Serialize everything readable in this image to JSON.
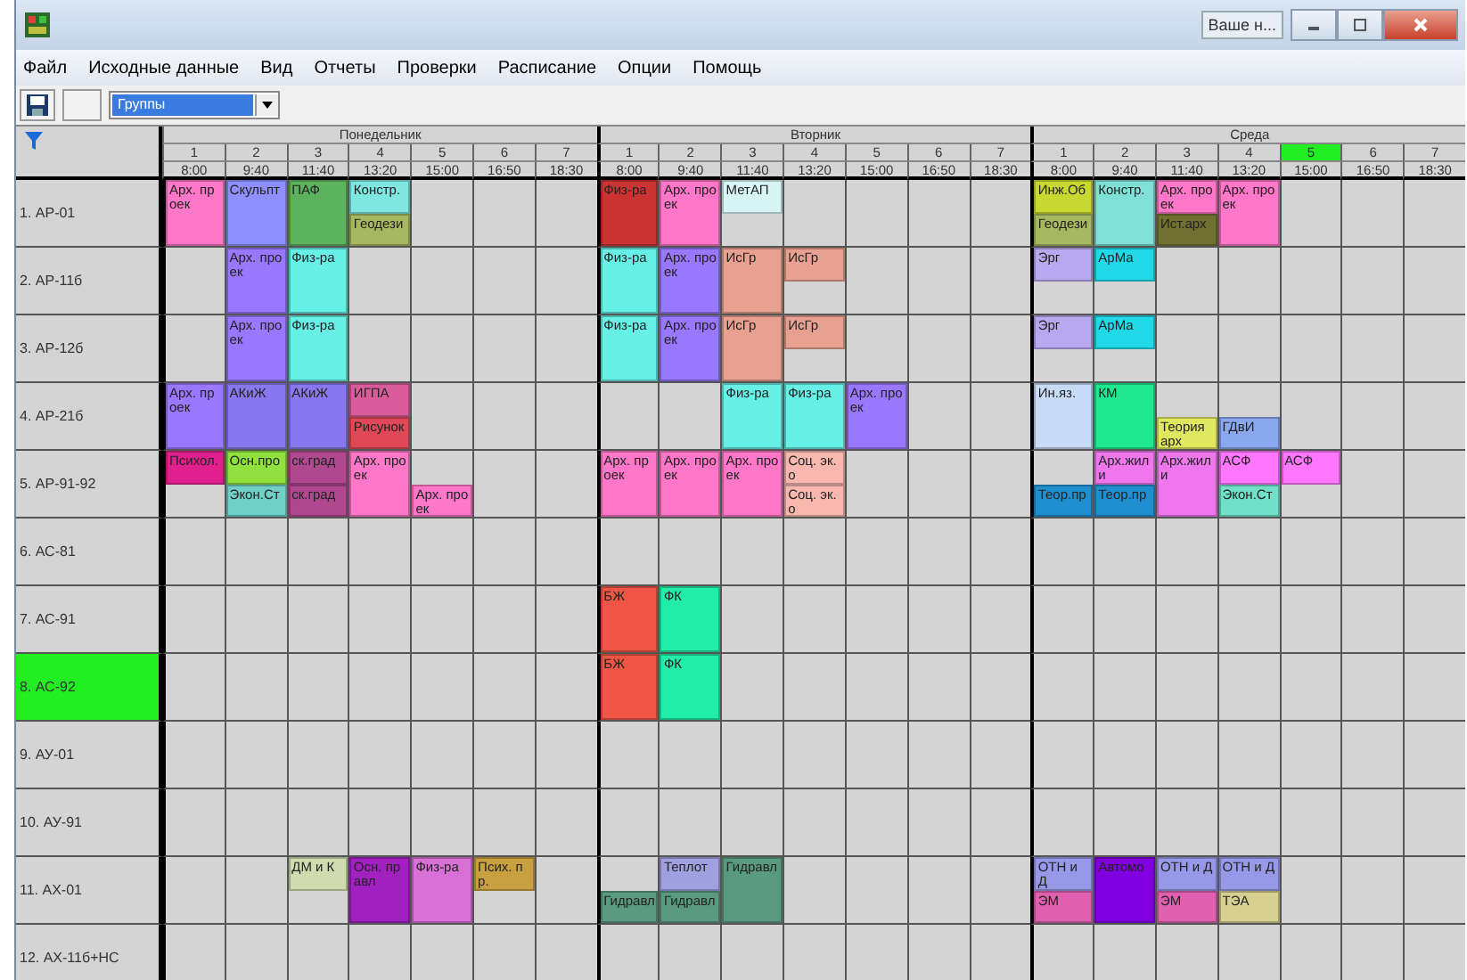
{
  "window": {
    "title_button": "Ваше н..."
  },
  "menu": [
    "Файл",
    "Исходные данные",
    "Вид",
    "Отчеты",
    "Проверки",
    "Расписание",
    "Опции",
    "Помощь"
  ],
  "toolbar": {
    "view_select": "Группы"
  },
  "days": [
    {
      "name": "Понедельник",
      "pairs": [
        {
          "number": "1",
          "time": "8:00",
          "selected": false
        },
        {
          "number": "2",
          "time": "9:40",
          "selected": false
        },
        {
          "number": "3",
          "time": "11:40",
          "selected": false
        },
        {
          "number": "4",
          "time": "13:20",
          "selected": false
        },
        {
          "number": "5",
          "time": "15:00",
          "selected": false
        },
        {
          "number": "6",
          "time": "16:50",
          "selected": false
        },
        {
          "number": "7",
          "time": "18:30",
          "selected": false
        }
      ]
    },
    {
      "name": "Вторник",
      "pairs": [
        {
          "number": "1",
          "time": "8:00",
          "selected": false
        },
        {
          "number": "2",
          "time": "9:40",
          "selected": false
        },
        {
          "number": "3",
          "time": "11:40",
          "selected": false
        },
        {
          "number": "4",
          "time": "13:20",
          "selected": false
        },
        {
          "number": "5",
          "time": "15:00",
          "selected": false
        },
        {
          "number": "6",
          "time": "16:50",
          "selected": false
        },
        {
          "number": "7",
          "time": "18:30",
          "selected": false
        }
      ]
    },
    {
      "name": "Среда",
      "pairs": [
        {
          "number": "1",
          "time": "8:00",
          "selected": false
        },
        {
          "number": "2",
          "time": "9:40",
          "selected": false
        },
        {
          "number": "3",
          "time": "11:40",
          "selected": false
        },
        {
          "number": "4",
          "time": "13:20",
          "selected": false
        },
        {
          "number": "5",
          "time": "15:00",
          "selected": true
        },
        {
          "number": "6",
          "time": "16:50",
          "selected": false
        },
        {
          "number": "7",
          "time": "18:30",
          "selected": false
        }
      ]
    }
  ],
  "groups": [
    {
      "name": "1. АР-01",
      "selected": false,
      "cells": [
        {
          "kind": "full",
          "label": "Арх. проек",
          "color": "#ff77c8"
        },
        {
          "kind": "full",
          "label": "Скульпт",
          "color": "#8f8fff"
        },
        {
          "kind": "full",
          "label": "ПАФ",
          "color": "#5db35d"
        },
        {
          "kind": "split",
          "top": {
            "label": "Констр.",
            "color": "#7fe6e0"
          },
          "bottom": {
            "label": "Геодези",
            "color": "#a8b860"
          }
        },
        {
          "kind": "empty"
        },
        {
          "kind": "empty"
        },
        {
          "kind": "empty"
        },
        {
          "kind": "full",
          "label": "Физ-ра",
          "color": "#cc3333"
        },
        {
          "kind": "full",
          "label": "Арх. проек",
          "color": "#ff77c8"
        },
        {
          "kind": "split",
          "top": {
            "label": "МетАП",
            "color": "#d8f5f5"
          }
        },
        {
          "kind": "empty"
        },
        {
          "kind": "empty"
        },
        {
          "kind": "empty"
        },
        {
          "kind": "empty"
        },
        {
          "kind": "split",
          "top": {
            "label": "Инж.Об",
            "color": "#c8d830"
          },
          "bottom": {
            "label": "Геодези",
            "color": "#a8b860"
          }
        },
        {
          "kind": "full",
          "label": "Констр.",
          "color": "#80e0d8"
        },
        {
          "kind": "split",
          "top": {
            "label": "Арх. проек",
            "color": "#ff77c8"
          },
          "bottom": {
            "label": "Ист.арх",
            "color": "#707030"
          }
        },
        {
          "kind": "full",
          "label": "Арх. проек",
          "color": "#ff77c8"
        },
        {
          "kind": "empty"
        },
        {
          "kind": "empty"
        },
        {
          "kind": "empty"
        }
      ]
    },
    {
      "name": "2. АР-11б",
      "selected": false,
      "cells": [
        {
          "kind": "empty"
        },
        {
          "kind": "full",
          "label": "Арх. проек",
          "color": "#9977ff"
        },
        {
          "kind": "full",
          "label": "Физ-ра",
          "color": "#66f0e6"
        },
        {
          "kind": "empty"
        },
        {
          "kind": "empty"
        },
        {
          "kind": "empty"
        },
        {
          "kind": "empty"
        },
        {
          "kind": "full",
          "label": "Физ-ра",
          "color": "#66f0e6"
        },
        {
          "kind": "full",
          "label": "Арх. проек",
          "color": "#9977ff"
        },
        {
          "kind": "full",
          "label": "ИсГр",
          "color": "#e8a090"
        },
        {
          "kind": "split",
          "top": {
            "label": "ИсГр",
            "color": "#e8a090"
          }
        },
        {
          "kind": "empty"
        },
        {
          "kind": "empty"
        },
        {
          "kind": "empty"
        },
        {
          "kind": "split",
          "top": {
            "label": "Эрг",
            "color": "#b8a8f0"
          }
        },
        {
          "kind": "split",
          "top": {
            "label": "АрМа",
            "color": "#20d8e8"
          }
        },
        {
          "kind": "empty"
        },
        {
          "kind": "empty"
        },
        {
          "kind": "empty"
        },
        {
          "kind": "empty"
        },
        {
          "kind": "empty"
        }
      ]
    },
    {
      "name": "3. АР-12б",
      "selected": false,
      "cells": [
        {
          "kind": "empty"
        },
        {
          "kind": "full",
          "label": "Арх. проек",
          "color": "#9977ff"
        },
        {
          "kind": "full",
          "label": "Физ-ра",
          "color": "#66f0e6"
        },
        {
          "kind": "empty"
        },
        {
          "kind": "empty"
        },
        {
          "kind": "empty"
        },
        {
          "kind": "empty"
        },
        {
          "kind": "full",
          "label": "Физ-ра",
          "color": "#66f0e6"
        },
        {
          "kind": "full",
          "label": "Арх. проек",
          "color": "#9977ff"
        },
        {
          "kind": "full",
          "label": "ИсГр",
          "color": "#e8a090"
        },
        {
          "kind": "split",
          "top": {
            "label": "ИсГр",
            "color": "#e8a090"
          }
        },
        {
          "kind": "empty"
        },
        {
          "kind": "empty"
        },
        {
          "kind": "empty"
        },
        {
          "kind": "split",
          "top": {
            "label": "Эрг",
            "color": "#b8a8f0"
          }
        },
        {
          "kind": "split",
          "top": {
            "label": "АрМа",
            "color": "#20d8e8"
          }
        },
        {
          "kind": "empty"
        },
        {
          "kind": "empty"
        },
        {
          "kind": "empty"
        },
        {
          "kind": "empty"
        },
        {
          "kind": "empty"
        }
      ]
    },
    {
      "name": "4. АР-21б",
      "selected": false,
      "cells": [
        {
          "kind": "full",
          "label": "Арх. проек",
          "color": "#9977ff"
        },
        {
          "kind": "full",
          "label": "АКиЖ",
          "color": "#8877ee"
        },
        {
          "kind": "full",
          "label": "АКиЖ",
          "color": "#8877ee"
        },
        {
          "kind": "split",
          "top": {
            "label": "ИГПА",
            "color": "#d85c9c"
          },
          "bottom": {
            "label": "Рисунок",
            "color": "#e04858"
          }
        },
        {
          "kind": "empty"
        },
        {
          "kind": "empty"
        },
        {
          "kind": "empty"
        },
        {
          "kind": "empty"
        },
        {
          "kind": "empty"
        },
        {
          "kind": "full",
          "label": "Физ-ра",
          "color": "#66f0e6"
        },
        {
          "kind": "full",
          "label": "Физ-ра",
          "color": "#66f0e6"
        },
        {
          "kind": "full",
          "label": "Арх. проек",
          "color": "#9977ff"
        },
        {
          "kind": "empty"
        },
        {
          "kind": "empty"
        },
        {
          "kind": "full",
          "label": "Ин.яз.",
          "color": "#c8dcf8"
        },
        {
          "kind": "full",
          "label": "КМ",
          "color": "#20e890"
        },
        {
          "kind": "split",
          "bottom": {
            "label": "Теория арх",
            "color": "#e0e860"
          }
        },
        {
          "kind": "split",
          "bottom": {
            "label": "ГДвИ",
            "color": "#8aa8f0"
          }
        },
        {
          "kind": "empty"
        },
        {
          "kind": "empty"
        },
        {
          "kind": "empty"
        }
      ]
    },
    {
      "name": "5. АР-91-92",
      "selected": false,
      "cells": [
        {
          "kind": "split",
          "top": {
            "label": "Психол.",
            "color": "#e0208c"
          }
        },
        {
          "kind": "split",
          "top": {
            "label": "Осн.про",
            "color": "#90e040"
          },
          "bottom": {
            "label": "Экон.Ст",
            "color": "#70d0c8"
          }
        },
        {
          "kind": "split",
          "top": {
            "label": "ск.град",
            "color": "#b04890"
          },
          "bottom": {
            "label": "ск.град",
            "color": "#b04890"
          }
        },
        {
          "kind": "full",
          "label": "Арх. проек",
          "color": "#ff77c8"
        },
        {
          "kind": "split",
          "bottom": {
            "label": "Арх. проек",
            "color": "#ff77c8"
          }
        },
        {
          "kind": "empty"
        },
        {
          "kind": "empty"
        },
        {
          "kind": "full",
          "label": "Арх. проек",
          "color": "#ff77c8"
        },
        {
          "kind": "full",
          "label": "Арх. проек",
          "color": "#ff77c8"
        },
        {
          "kind": "full",
          "label": "Арх. проек",
          "color": "#ff77c8"
        },
        {
          "kind": "split",
          "top": {
            "label": "Соц. эк. о",
            "color": "#f8b8b0"
          },
          "bottom": {
            "label": "Соц. эк. о",
            "color": "#f8b8b0"
          }
        },
        {
          "kind": "empty"
        },
        {
          "kind": "empty"
        },
        {
          "kind": "empty"
        },
        {
          "kind": "split",
          "bottom": {
            "label": "Теор.пр",
            "color": "#1f8fd0"
          }
        },
        {
          "kind": "split",
          "top": {
            "label": "Арх.жил и",
            "color": "#ee77ee"
          },
          "bottom": {
            "label": "Теор.пр",
            "color": "#1f8fd0"
          }
        },
        {
          "kind": "full",
          "label": "Арх.жил и",
          "color": "#ee77ee"
        },
        {
          "kind": "split",
          "top": {
            "label": "АСФ",
            "color": "#ff77ff"
          },
          "bottom": {
            "label": "Экон.Ст",
            "color": "#70e0c8"
          }
        },
        {
          "kind": "split",
          "top": {
            "label": "АСФ",
            "color": "#ff77ff"
          }
        },
        {
          "kind": "empty"
        },
        {
          "kind": "empty"
        }
      ]
    },
    {
      "name": "6. АС-81",
      "selected": false,
      "cells": [
        {
          "kind": "empty"
        },
        {
          "kind": "empty"
        },
        {
          "kind": "empty"
        },
        {
          "kind": "empty"
        },
        {
          "kind": "empty"
        },
        {
          "kind": "empty"
        },
        {
          "kind": "empty"
        },
        {
          "kind": "empty"
        },
        {
          "kind": "empty"
        },
        {
          "kind": "empty"
        },
        {
          "kind": "empty"
        },
        {
          "kind": "empty"
        },
        {
          "kind": "empty"
        },
        {
          "kind": "empty"
        },
        {
          "kind": "empty"
        },
        {
          "kind": "empty"
        },
        {
          "kind": "empty"
        },
        {
          "kind": "empty"
        },
        {
          "kind": "empty"
        },
        {
          "kind": "empty"
        },
        {
          "kind": "empty"
        }
      ]
    },
    {
      "name": "7. АС-91",
      "selected": false,
      "cells": [
        {
          "kind": "empty"
        },
        {
          "kind": "empty"
        },
        {
          "kind": "empty"
        },
        {
          "kind": "empty"
        },
        {
          "kind": "empty"
        },
        {
          "kind": "empty"
        },
        {
          "kind": "empty"
        },
        {
          "kind": "full",
          "label": "БЖ",
          "color": "#ee5544"
        },
        {
          "kind": "full",
          "label": "ФК",
          "color": "#22eeaa"
        },
        {
          "kind": "empty"
        },
        {
          "kind": "empty"
        },
        {
          "kind": "empty"
        },
        {
          "kind": "empty"
        },
        {
          "kind": "empty"
        },
        {
          "kind": "empty"
        },
        {
          "kind": "empty"
        },
        {
          "kind": "empty"
        },
        {
          "kind": "empty"
        },
        {
          "kind": "empty"
        },
        {
          "kind": "empty"
        },
        {
          "kind": "empty"
        }
      ]
    },
    {
      "name": "8. АС-92",
      "selected": true,
      "cells": [
        {
          "kind": "empty"
        },
        {
          "kind": "empty"
        },
        {
          "kind": "empty"
        },
        {
          "kind": "empty"
        },
        {
          "kind": "empty"
        },
        {
          "kind": "empty"
        },
        {
          "kind": "empty"
        },
        {
          "kind": "full",
          "label": "БЖ",
          "color": "#ee5544"
        },
        {
          "kind": "full",
          "label": "ФК",
          "color": "#22eeaa"
        },
        {
          "kind": "empty"
        },
        {
          "kind": "empty"
        },
        {
          "kind": "empty"
        },
        {
          "kind": "empty"
        },
        {
          "kind": "empty"
        },
        {
          "kind": "empty"
        },
        {
          "kind": "empty"
        },
        {
          "kind": "empty"
        },
        {
          "kind": "empty"
        },
        {
          "kind": "empty"
        },
        {
          "kind": "empty"
        },
        {
          "kind": "empty"
        }
      ]
    },
    {
      "name": "9. АУ-01",
      "selected": false,
      "cells": [
        {
          "kind": "empty"
        },
        {
          "kind": "empty"
        },
        {
          "kind": "empty"
        },
        {
          "kind": "empty"
        },
        {
          "kind": "empty"
        },
        {
          "kind": "empty"
        },
        {
          "kind": "empty"
        },
        {
          "kind": "empty"
        },
        {
          "kind": "empty"
        },
        {
          "kind": "empty"
        },
        {
          "kind": "empty"
        },
        {
          "kind": "empty"
        },
        {
          "kind": "empty"
        },
        {
          "kind": "empty"
        },
        {
          "kind": "empty"
        },
        {
          "kind": "empty"
        },
        {
          "kind": "empty"
        },
        {
          "kind": "empty"
        },
        {
          "kind": "empty"
        },
        {
          "kind": "empty"
        },
        {
          "kind": "empty"
        }
      ]
    },
    {
      "name": "10. АУ-91",
      "selected": false,
      "cells": [
        {
          "kind": "empty"
        },
        {
          "kind": "empty"
        },
        {
          "kind": "empty"
        },
        {
          "kind": "empty"
        },
        {
          "kind": "empty"
        },
        {
          "kind": "empty"
        },
        {
          "kind": "empty"
        },
        {
          "kind": "empty"
        },
        {
          "kind": "empty"
        },
        {
          "kind": "empty"
        },
        {
          "kind": "empty"
        },
        {
          "kind": "empty"
        },
        {
          "kind": "empty"
        },
        {
          "kind": "empty"
        },
        {
          "kind": "empty"
        },
        {
          "kind": "empty"
        },
        {
          "kind": "empty"
        },
        {
          "kind": "empty"
        },
        {
          "kind": "empty"
        },
        {
          "kind": "empty"
        },
        {
          "kind": "empty"
        }
      ]
    },
    {
      "name": "11. АХ-01",
      "selected": false,
      "cells": [
        {
          "kind": "empty"
        },
        {
          "kind": "empty"
        },
        {
          "kind": "split",
          "top": {
            "label": "ДМ и К",
            "color": "#d0dcb0"
          }
        },
        {
          "kind": "full",
          "label": "Осн. правл",
          "color": "#a020c0"
        },
        {
          "kind": "full",
          "label": "Физ-ра",
          "color": "#d870d8"
        },
        {
          "kind": "split",
          "top": {
            "label": "Псих. пр.",
            "color": "#c8a040"
          }
        },
        {
          "kind": "empty"
        },
        {
          "kind": "split",
          "bottom": {
            "label": "Гидравл",
            "color": "#5a9a80"
          }
        },
        {
          "kind": "split",
          "top": {
            "label": "Теплот",
            "color": "#a0a0e0"
          },
          "bottom": {
            "label": "Гидравл",
            "color": "#5a9a80"
          }
        },
        {
          "kind": "full",
          "label": "Гидравл",
          "color": "#5a9a80"
        },
        {
          "kind": "empty"
        },
        {
          "kind": "empty"
        },
        {
          "kind": "empty"
        },
        {
          "kind": "empty"
        },
        {
          "kind": "split",
          "top": {
            "label": "ОТН и Д",
            "color": "#9898e8"
          },
          "bottom": {
            "label": "ЭМ",
            "color": "#e060b0"
          }
        },
        {
          "kind": "full",
          "label": "Автомо",
          "color": "#8000e0"
        },
        {
          "kind": "split",
          "top": {
            "label": "ОТН и Д",
            "color": "#9898e8"
          },
          "bottom": {
            "label": "ЭМ",
            "color": "#e060b0"
          }
        },
        {
          "kind": "split",
          "top": {
            "label": "ОТН и Д",
            "color": "#9898e8"
          },
          "bottom": {
            "label": "ТЭА",
            "color": "#d8d090"
          }
        },
        {
          "kind": "empty"
        },
        {
          "kind": "empty"
        },
        {
          "kind": "empty"
        }
      ]
    },
    {
      "name": "12. АХ-11б+НС",
      "selected": false,
      "cells": [
        {
          "kind": "empty"
        },
        {
          "kind": "empty"
        },
        {
          "kind": "empty"
        },
        {
          "kind": "empty"
        },
        {
          "kind": "empty"
        },
        {
          "kind": "empty"
        },
        {
          "kind": "empty"
        },
        {
          "kind": "empty"
        },
        {
          "kind": "empty"
        },
        {
          "kind": "empty"
        },
        {
          "kind": "empty"
        },
        {
          "kind": "empty"
        },
        {
          "kind": "empty"
        },
        {
          "kind": "empty"
        },
        {
          "kind": "empty"
        },
        {
          "kind": "empty"
        },
        {
          "kind": "empty"
        },
        {
          "kind": "empty"
        },
        {
          "kind": "empty"
        },
        {
          "kind": "empty"
        },
        {
          "kind": "empty"
        }
      ]
    }
  ]
}
